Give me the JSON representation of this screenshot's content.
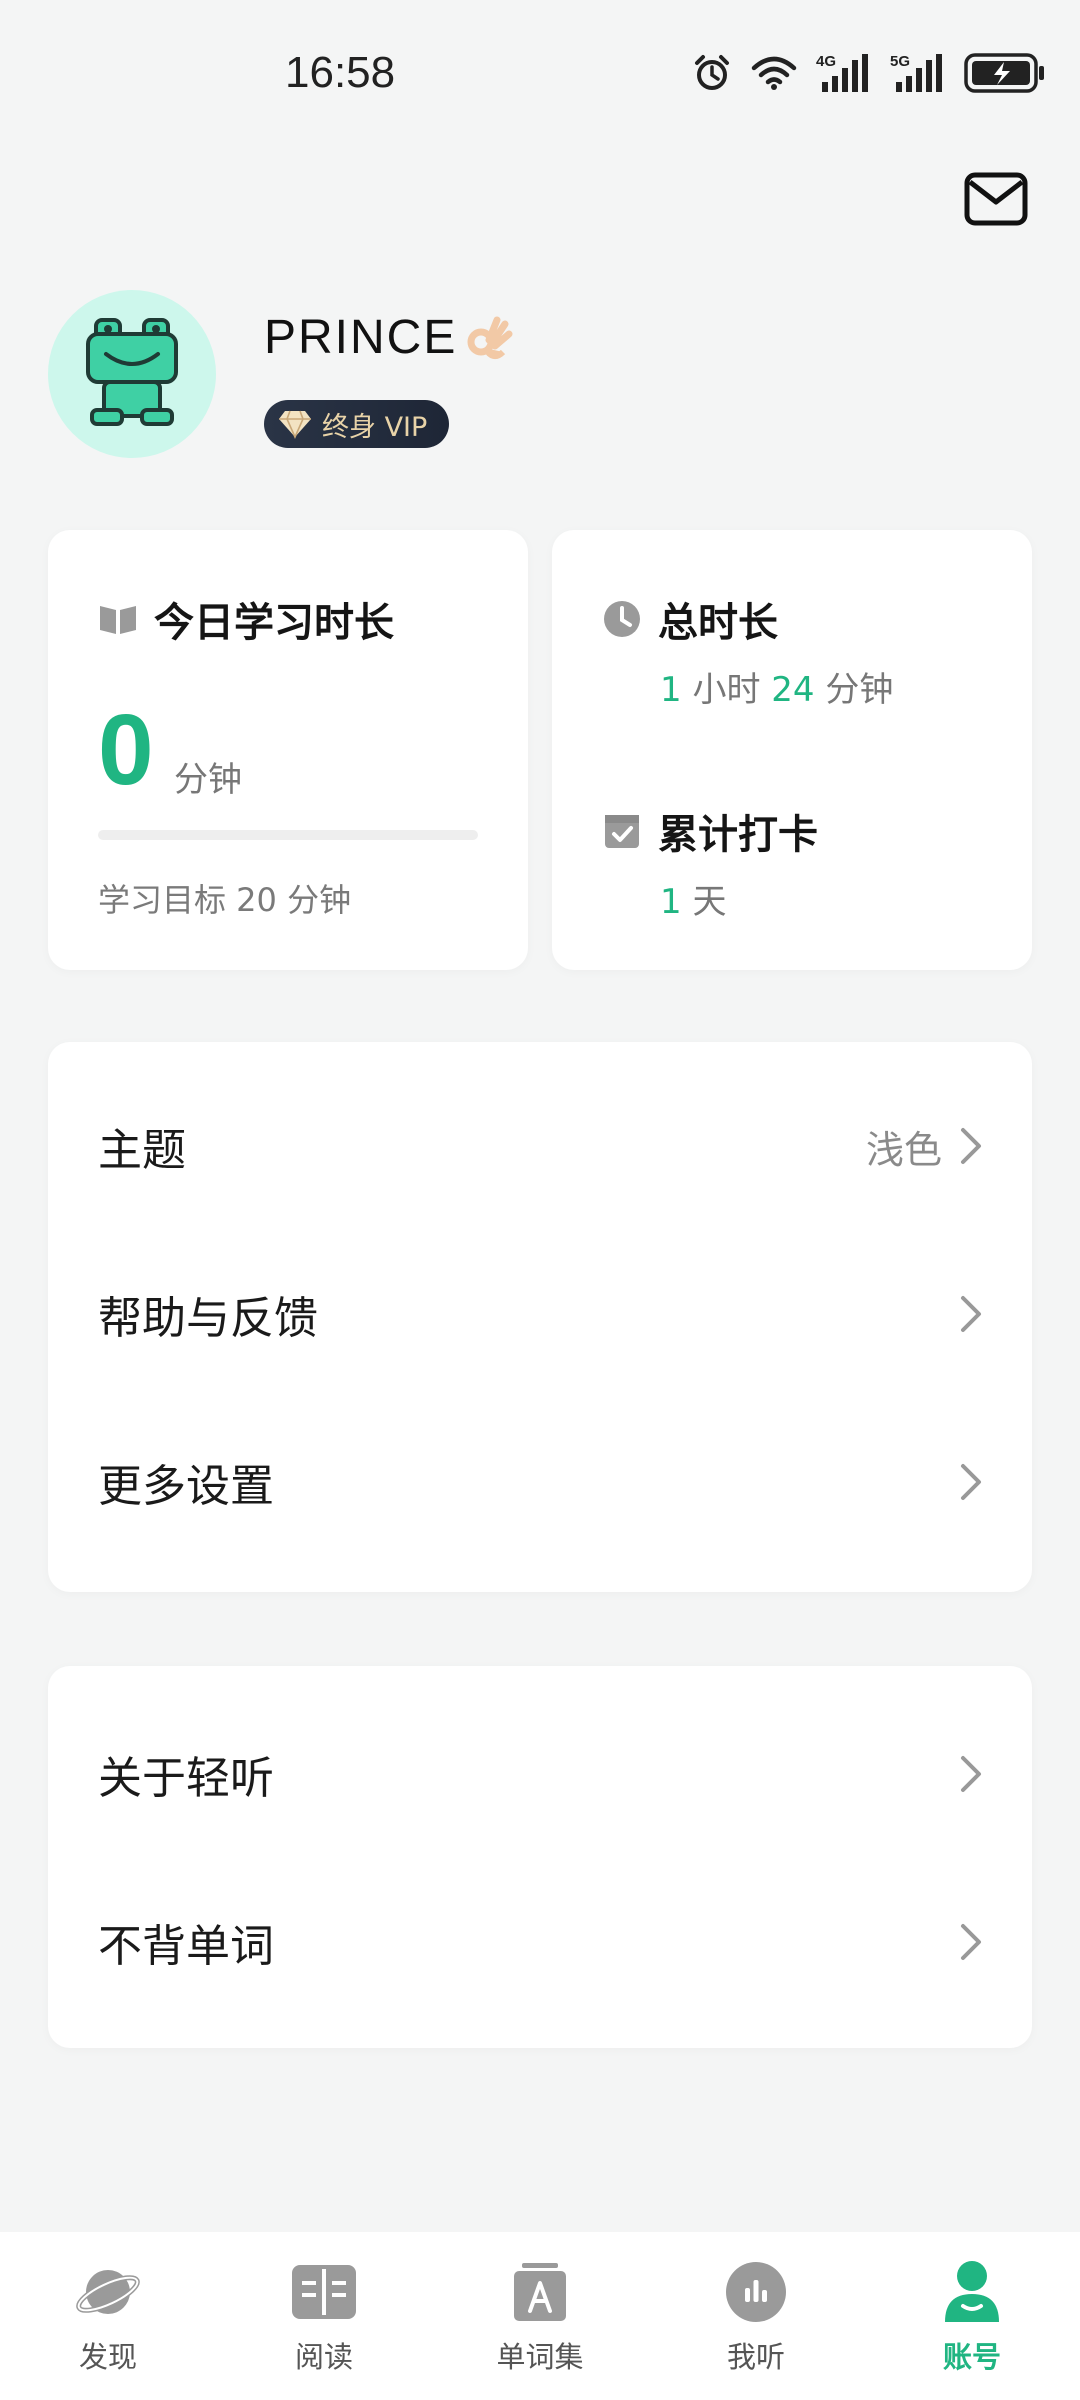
{
  "status_bar": {
    "time": "16:58",
    "icons": [
      "alarm-icon",
      "wifi-icon",
      "signal-4g-icon",
      "signal-5g-icon",
      "battery-charging-icon"
    ],
    "net1": "4G",
    "net2": "5G"
  },
  "header": {
    "mail_icon": "mail-icon"
  },
  "profile": {
    "username": "PRINCE",
    "emoji": "ok-hand",
    "vip_label": "终身 VIP"
  },
  "today_card": {
    "title": "今日学习时长",
    "minutes": "0",
    "unit": "分钟",
    "progress": 0,
    "goal": "学习目标 20 分钟"
  },
  "total_card": {
    "total_title": "总时长",
    "hours": "1",
    "hours_unit": "小时",
    "minutes": "24",
    "minutes_unit": "分钟",
    "checkin_title": "累计打卡",
    "days": "1",
    "days_unit": "天"
  },
  "menu_group_1": [
    {
      "label": "主题",
      "value": "浅色"
    },
    {
      "label": "帮助与反馈",
      "value": ""
    },
    {
      "label": "更多设置",
      "value": ""
    }
  ],
  "menu_group_2": [
    {
      "label": "关于轻听",
      "value": ""
    },
    {
      "label": "不背单词",
      "value": ""
    }
  ],
  "bottom_nav": [
    {
      "label": "发现",
      "icon": "planet-icon",
      "active": false
    },
    {
      "label": "阅读",
      "icon": "book-icon",
      "active": false
    },
    {
      "label": "单词集",
      "icon": "word-book-icon",
      "active": false
    },
    {
      "label": "我听",
      "icon": "audio-bars-icon",
      "active": false
    },
    {
      "label": "账号",
      "icon": "person-icon",
      "active": true
    }
  ],
  "colors": {
    "accent": "#20b582",
    "background": "#f4f5f5",
    "avatar_bg": "#cdf7ec",
    "vip_bg": "#1e2636",
    "vip_text": "#e8d3a8"
  }
}
